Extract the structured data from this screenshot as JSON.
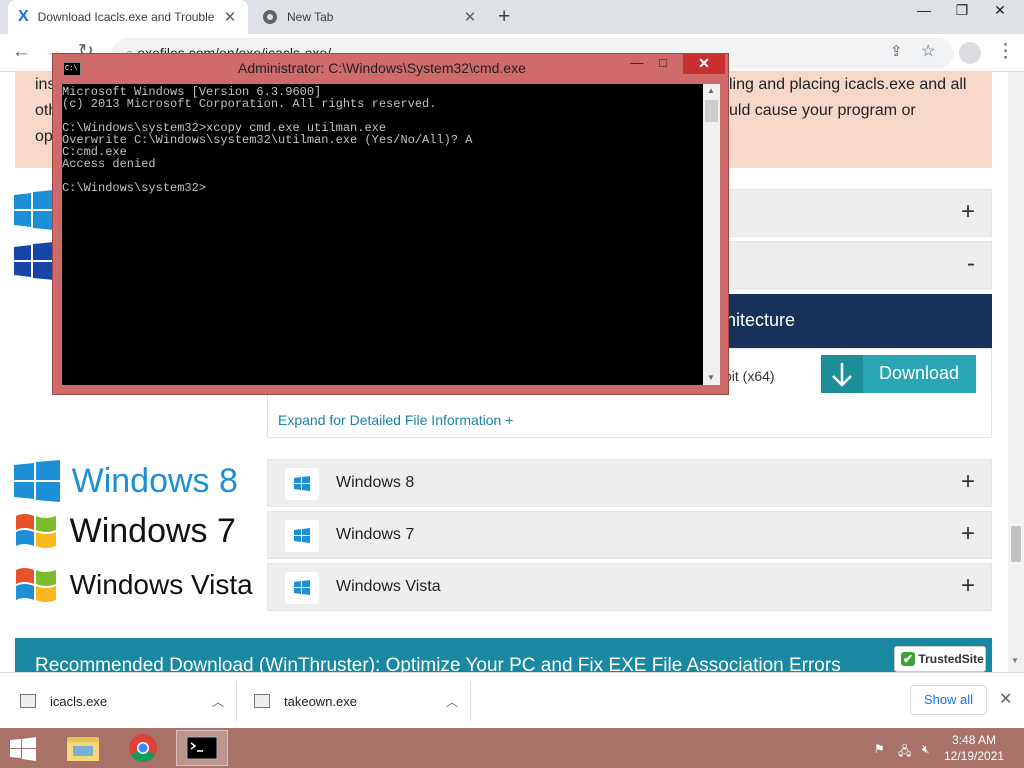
{
  "browser": {
    "tabs": [
      {
        "title": "Download Icacls.exe and Trouble",
        "close": "✕"
      },
      {
        "title": "New Tab",
        "close": "✕"
      }
    ],
    "new_tab": "+",
    "window_controls": {
      "minimize": "—",
      "restore": "❐",
      "close": "✕"
    },
    "url": "exefiles.com/en/exe/icacls-exe/",
    "nav": {
      "back": "←",
      "forward": "→",
      "reload": "↻",
      "more": "⋮"
    }
  },
  "page": {
    "banner_lines": [
      "ling and placing icacls.exe and all",
      "uld cause your program or"
    ],
    "banner_prefix": [
      "ins",
      "oth",
      "op"
    ],
    "accordion_top": [
      {
        "sign": "+"
      },
      {
        "sign": "-"
      }
    ],
    "architecture_header": "chitecture",
    "arch_value": "bit (x64)",
    "download_button": "Download",
    "expand_link": "Expand for Detailed File Information +",
    "os_logos": [
      "Windows 8",
      "Windows 7",
      "Windows Vista"
    ],
    "os_rows": [
      {
        "label": "Windows 8",
        "sign": "+"
      },
      {
        "label": "Windows 7",
        "sign": "+"
      },
      {
        "label": "Windows Vista",
        "sign": "+"
      }
    ],
    "recommended": "Recommended Download (WinThruster): Optimize Your PC and Fix EXE File Association Errors",
    "trusted_badge": "TrustedSite"
  },
  "cmd": {
    "title": "Administrator: C:\\Windows\\System32\\cmd.exe",
    "controls": {
      "minimize": "—",
      "maximize": "□",
      "close": "✕"
    },
    "lines": [
      "Microsoft Windows [Version 6.3.9600]",
      "(c) 2013 Microsoft Corporation. All rights reserved.",
      "",
      "C:\\Windows\\system32>xcopy cmd.exe utilman.exe",
      "Overwrite C:\\Windows\\system32\\utilman.exe (Yes/No/All)? A",
      "C:cmd.exe",
      "Access denied",
      "",
      "C:\\Windows\\system32>"
    ]
  },
  "downloads": {
    "items": [
      {
        "name": "icacls.exe"
      },
      {
        "name": "takeown.exe"
      }
    ],
    "show_all": "Show all",
    "close": "✕"
  },
  "taskbar": {
    "time": "3:48 AM",
    "date": "12/19/2021"
  }
}
